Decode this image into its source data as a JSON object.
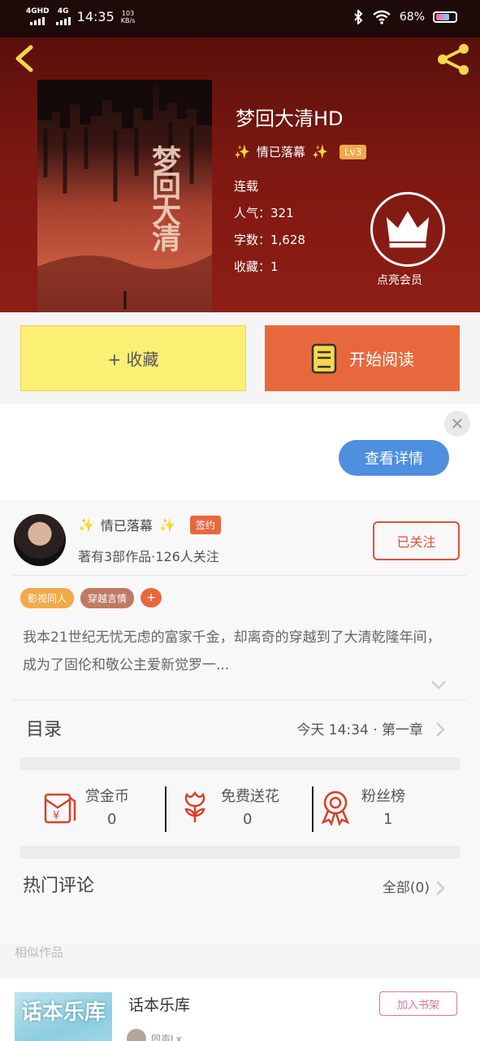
{
  "status_bar": {
    "signal1": "4GHD",
    "signal2": "4G",
    "time": "14:35",
    "speed": "103\nKB/s",
    "battery": "68%"
  },
  "book": {
    "title": "梦回大清HD",
    "cover_title": "梦回大清",
    "author": "情已落幕",
    "level": "Lv3",
    "status": "连载",
    "popularity": "人气：321",
    "word_count": "字数：1,628",
    "favorites": "收藏：1",
    "vip_label": "点亮会员"
  },
  "actions": {
    "favorite_label": "+ 收藏",
    "read_label": "开始阅读"
  },
  "ad": {
    "detail_label": "查看详情",
    "close_glyph": "✕"
  },
  "author_card": {
    "name": "情已落幕",
    "signed_badge": "签约",
    "stats": "著有3部作品·126人关注",
    "follow_label": "已关注",
    "tags": [
      {
        "label": "影视同人",
        "color": "#f2a94a"
      },
      {
        "label": "穿越言情",
        "color": "#c07a63"
      }
    ],
    "tag_plus": "+",
    "synopsis": "我本21世纪无忧无虑的富家千金，却离奇的穿越到了大清乾隆年间，成为了固伦和敬公主爱新觉罗一..."
  },
  "toc": {
    "title": "目录",
    "latest": "今天 14:34 · 第一章"
  },
  "stats": [
    {
      "label": "赏金币",
      "value": "0",
      "icon": "red-envelope-icon"
    },
    {
      "label": "免费送花",
      "value": "0",
      "icon": "flower-icon"
    },
    {
      "label": "粉丝榜",
      "value": "1",
      "icon": "medal-icon"
    }
  ],
  "comments": {
    "title": "热门评论",
    "all_label": "全部(0)"
  },
  "similar": {
    "heading": "相似作品",
    "items": [
      {
        "title": "话本乐库",
        "cover_title": "话本乐库",
        "add_label": "加入书架",
        "author": "同声Lx"
      }
    ]
  },
  "colors": {
    "accent": "#e8683e",
    "favorite_bg": "#fbef74",
    "hero_bg": "#7d1812",
    "link_blue": "#4e8fe0"
  }
}
